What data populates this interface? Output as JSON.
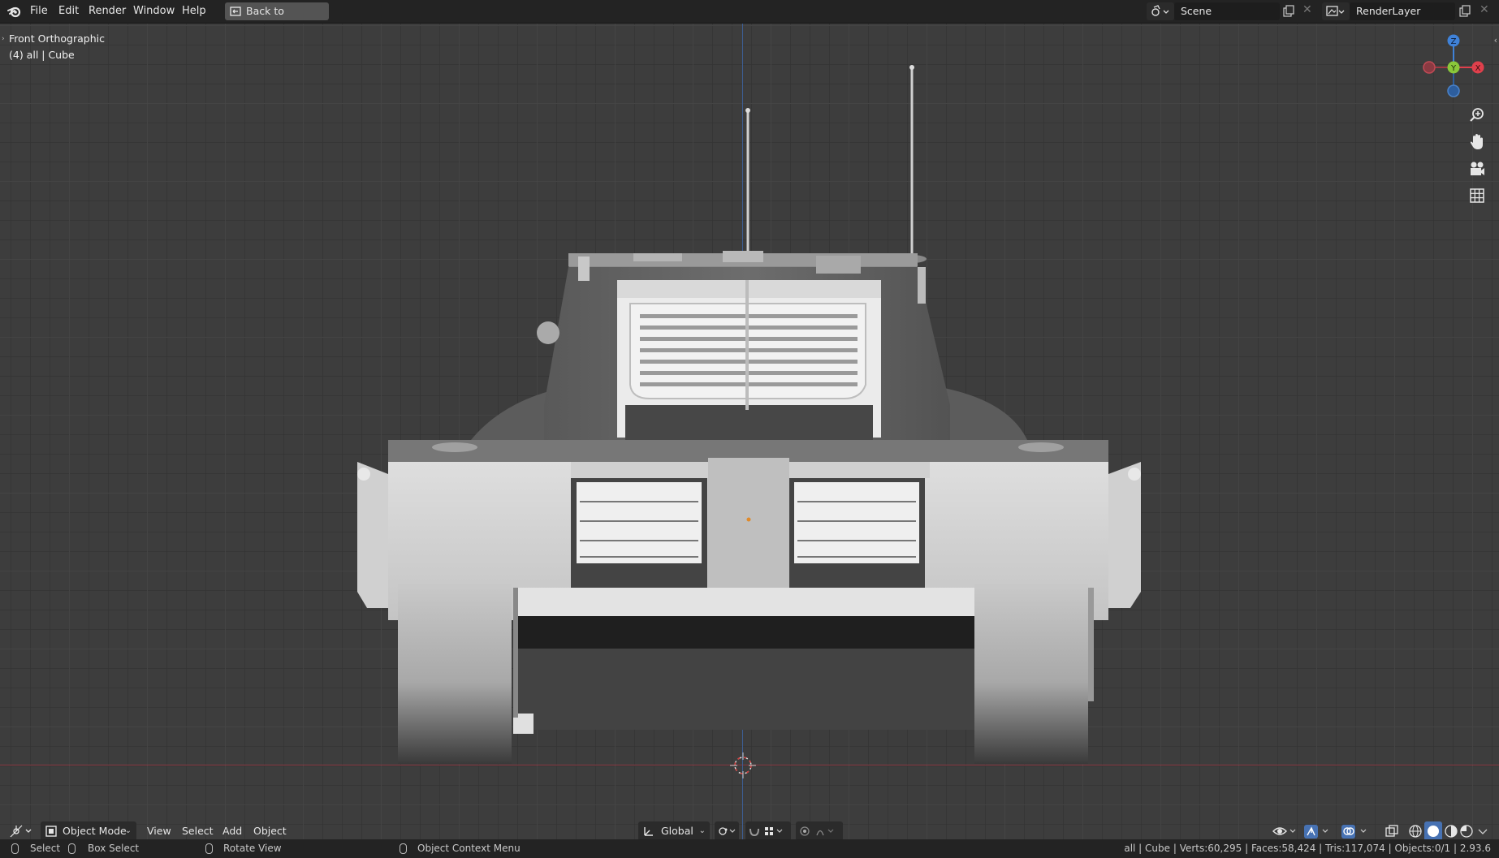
{
  "topbar": {
    "menus": [
      "File",
      "Edit",
      "Render",
      "Window",
      "Help"
    ],
    "back_button": "Back to Previous",
    "scene": "Scene",
    "render_layer": "RenderLayer"
  },
  "viewport": {
    "view_name": "Front Orthographic",
    "collection_info": "(4) all | Cube",
    "gizmo": {
      "z": "Z",
      "y": "Y",
      "x": "X"
    },
    "nav_icons": [
      "zoom-icon",
      "hand-pan-icon",
      "camera-icon",
      "grid-icon"
    ]
  },
  "header": {
    "mode": "Object Mode",
    "menus": [
      "View",
      "Select",
      "Add",
      "Object"
    ],
    "orientation": "Global"
  },
  "statusbar": {
    "select": "Select",
    "box_select": "Box Select",
    "rotate_view": "Rotate View",
    "context_menu": "Object Context Menu",
    "stats": "all | Cube | Verts:60,295 | Faces:58,424 | Tris:117,074 | Objects:0/1 | 2.93.6"
  },
  "colors": {
    "accent_blue": "#4772b3",
    "axis_x": "#e0404c",
    "axis_y": "#8ac83a",
    "axis_z": "#3f82d9"
  }
}
